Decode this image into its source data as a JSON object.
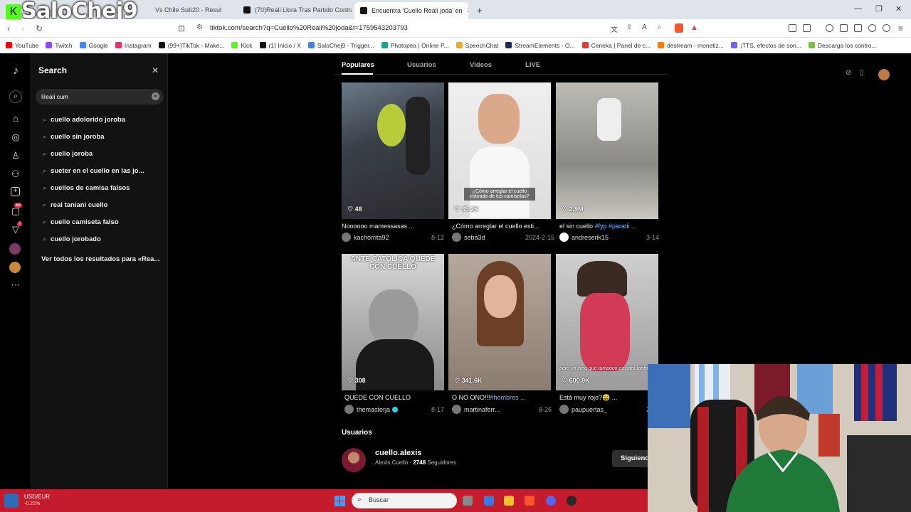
{
  "browser": {
    "tabs": [
      {
        "title": "(7"
      },
      {
        "title": "Vs Chile Sub20 - Resul"
      },
      {
        "title": "(70)Reali Llora Tras Partido Contra G"
      },
      {
        "title": "Encuentra 'Cuello Reali joda' en"
      }
    ],
    "watermark": "SaloChej9",
    "url": "tiktok.com/search?q=Cuello%20Reali%20joda&t=1759543203793",
    "bookmarks": [
      {
        "label": "YouTube",
        "color": "#ff0000"
      },
      {
        "label": "Twitch",
        "color": "#9146ff"
      },
      {
        "label": "Google",
        "color": "#4285f4"
      },
      {
        "label": "Instagram",
        "color": "#e1306c"
      },
      {
        "label": "(99+)TikTok - Make...",
        "color": "#111111"
      },
      {
        "label": "Kick",
        "color": "#53fc18"
      },
      {
        "label": "(1) Inicio / X",
        "color": "#111111"
      },
      {
        "label": "SaloChej9 - Trigger...",
        "color": "#3b82f6"
      },
      {
        "label": "Photopea | Online P...",
        "color": "#1aa38b"
      },
      {
        "label": "SpeechChat",
        "color": "#f5a623"
      },
      {
        "label": "StreamElements - O...",
        "color": "#1c2a5a"
      },
      {
        "label": "Ceneka | Panel de c...",
        "color": "#e03a3a"
      },
      {
        "label": "destream - monetiz...",
        "color": "#ff7a00"
      },
      {
        "label": "¡TTS, efectos de son...",
        "color": "#7a5af8"
      },
      {
        "label": "Descarga los contro...",
        "color": "#7fbf3f"
      }
    ]
  },
  "search_panel": {
    "title": "Search",
    "input_value": "Reali cum",
    "suggestions": [
      "cuello adolorido joroba",
      "cuello sin joroba",
      "cuello joroba",
      "sueter en el cuello en las jo...",
      "cuellos de camisa falsos",
      "real taniani cuello",
      "cuello camiseta falso",
      "cuello jorobado"
    ],
    "see_all": "Ver todos los resultados para «Rea..."
  },
  "results_tabs": [
    "Populares",
    "Usuarios",
    "Videos",
    "LIVE"
  ],
  "videos": [
    {
      "likes": "48",
      "caption": "Noooooo mamessasas ...",
      "user": "kachorrita92",
      "date": "8-12",
      "overlay": ""
    },
    {
      "likes": "35.2K",
      "caption": "¿Cómo arreglar el cuello esti...",
      "user": "seba3d",
      "date": "2024-2-15",
      "overlay": "¿Cómo arreglar el cuello estirado de tus camisetas?"
    },
    {
      "likes": "2.9M",
      "caption": "el sin cuello ",
      "caption_tags": "#fyp #paratii ...",
      "user": "andreserik15",
      "date": "3-14",
      "overlay": ""
    },
    {
      "likes": "308",
      "caption": "QUEDE CON CUELLO",
      "user": "themasterja",
      "date": "8-17",
      "overlay": "ANTE CATOLICA QUEDE CON CUELLO"
    },
    {
      "likes": "341.6K",
      "caption": "O NO ONO!!!",
      "caption_tags": "#hombres ...",
      "user": "martinaferr...",
      "date": "8-26",
      "overlay": ""
    },
    {
      "likes": "600.9K",
      "caption": "Está muy rojo?😅 ...",
      "user": "paupuertas_",
      "date": "2023-3",
      "overlay": "pero yo creo que tampoco es para tanto no"
    }
  ],
  "users_section": {
    "heading": "Usuarios",
    "handle": "cuello.alexis",
    "name": "Alexis Cuello",
    "followers": "2748",
    "followers_label": "Seguidores",
    "follow_button": "Siguiendo"
  },
  "taskbar": {
    "fx_label": "USD/EUR",
    "fx_change": "-0.22%",
    "search_label": "Buscar"
  },
  "badges": {
    "inbox": "68",
    "activity": "7"
  }
}
